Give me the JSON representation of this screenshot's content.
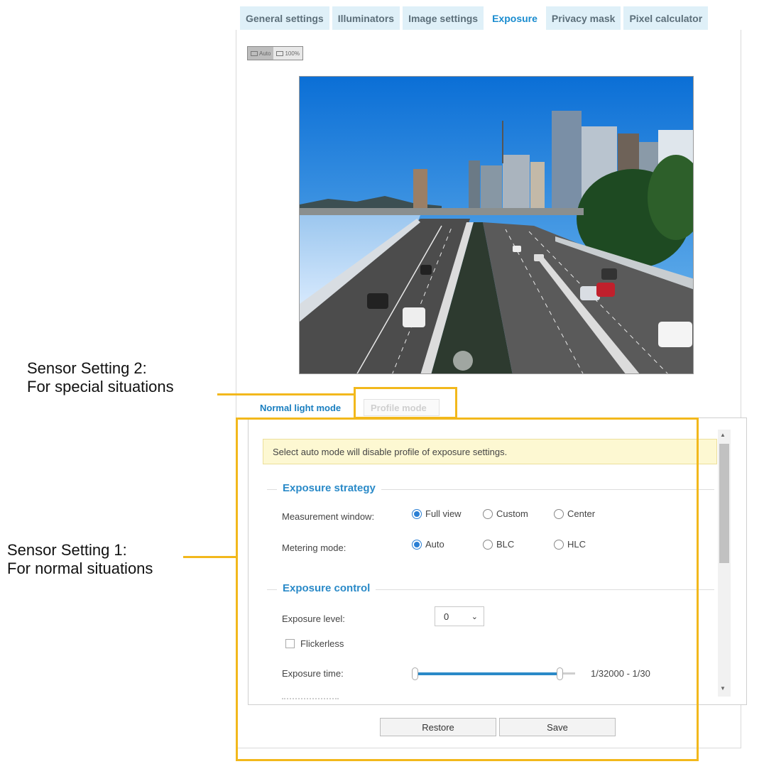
{
  "tabs": [
    {
      "label": "General settings"
    },
    {
      "label": "Illuminators"
    },
    {
      "label": "Image settings"
    },
    {
      "label": "Exposure"
    },
    {
      "label": "Privacy mask"
    },
    {
      "label": "Pixel calculator"
    }
  ],
  "active_tab": "Exposure",
  "view_buttons": [
    {
      "label": "Auto"
    },
    {
      "label": "100%"
    }
  ],
  "mode_tabs": {
    "normal": "Normal light mode",
    "profile": "Profile mode"
  },
  "notice": "Select auto mode will disable profile of exposure settings.",
  "exposure_strategy": {
    "title": "Exposure strategy",
    "measurement_window": {
      "label": "Measurement window:",
      "options": [
        "Full view",
        "Custom",
        "Center"
      ],
      "selected": "Full view"
    },
    "metering_mode": {
      "label": "Metering mode:",
      "options": [
        "Auto",
        "BLC",
        "HLC"
      ],
      "selected": "Auto"
    }
  },
  "exposure_control": {
    "title": "Exposure control",
    "exposure_level": {
      "label": "Exposure level:",
      "value": "0"
    },
    "flickerless": {
      "label": "Flickerless",
      "checked": false
    },
    "exposure_time": {
      "label": "Exposure time:",
      "value": "1/32000 - 1/30"
    }
  },
  "buttons": {
    "restore": "Restore",
    "save": "Save"
  },
  "callouts": {
    "setting2_line1": "Sensor Setting 2:",
    "setting2_line2": "For special situations",
    "setting1_line1": "Sensor Setting 1:",
    "setting1_line2": "For normal situations"
  },
  "colors": {
    "accent": "#1a8ccf",
    "highlight": "#f2b81c",
    "notice_bg": "#fdf8d2"
  }
}
